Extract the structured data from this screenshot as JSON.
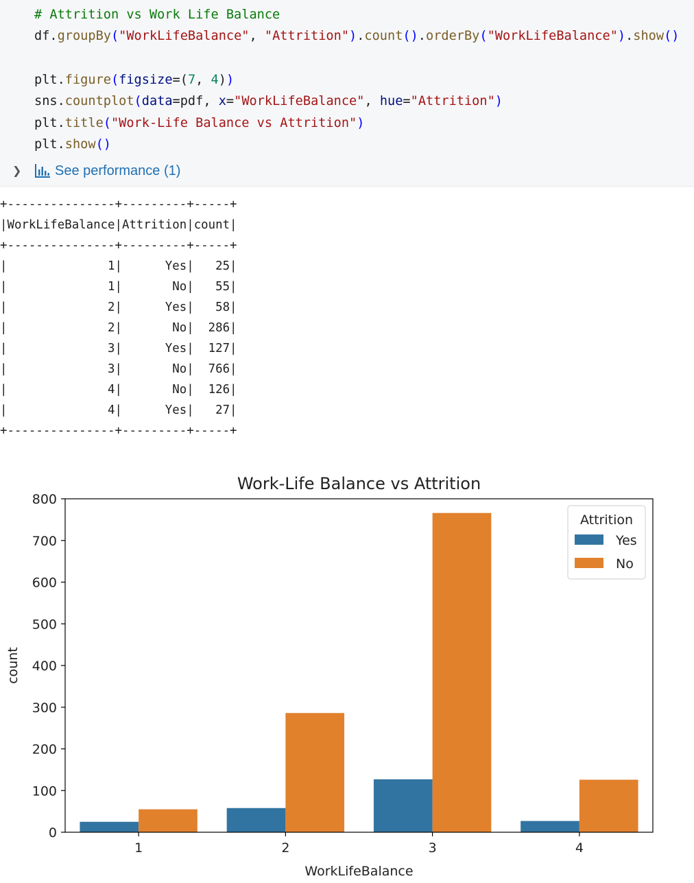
{
  "code_cell": {
    "comment": "# Attrition vs Work Life Balance",
    "line2": {
      "obj": "df",
      "fn1": "groupBy",
      "arg1": "\"WorkLifeBalance\"",
      "arg2": "\"Attrition\"",
      "fn2": "count",
      "fn3": "orderBy",
      "arg3": "\"WorkLifeBalance\"",
      "fn4": "show"
    },
    "line4": {
      "obj": "plt",
      "fn": "figure",
      "param": "figsize",
      "n1": "7",
      "n2": "4"
    },
    "line5": {
      "obj": "sns",
      "fn": "countplot",
      "p1": "data",
      "v1": "pdf",
      "p2": "x",
      "v2": "\"WorkLifeBalance\"",
      "p3": "hue",
      "v3": "\"Attrition\""
    },
    "line6": {
      "obj": "plt",
      "fn": "title",
      "arg": "\"Work-Life Balance vs Attrition\""
    },
    "line7": {
      "obj": "plt",
      "fn": "show"
    },
    "performance_link": "See performance (1)"
  },
  "table_output": {
    "border": "+---------------+---------+-----+",
    "headers": [
      "WorkLifeBalance",
      "Attrition",
      "count"
    ],
    "rows": [
      [
        "1",
        "Yes",
        "25"
      ],
      [
        "1",
        "No",
        "55"
      ],
      [
        "2",
        "Yes",
        "58"
      ],
      [
        "2",
        "No",
        "286"
      ],
      [
        "3",
        "Yes",
        "127"
      ],
      [
        "3",
        "No",
        "766"
      ],
      [
        "4",
        "No",
        "126"
      ],
      [
        "4",
        "Yes",
        "27"
      ]
    ]
  },
  "chart_data": {
    "type": "bar",
    "title": "Work-Life Balance vs Attrition",
    "xlabel": "WorkLifeBalance",
    "ylabel": "count",
    "categories": [
      "1",
      "2",
      "3",
      "4"
    ],
    "series": [
      {
        "name": "Yes",
        "values": [
          25,
          58,
          127,
          27
        ],
        "color": "#3274a1"
      },
      {
        "name": "No",
        "values": [
          55,
          286,
          766,
          126
        ],
        "color": "#e1812c"
      }
    ],
    "ylim": [
      0,
      800
    ],
    "yticks": [
      0,
      100,
      200,
      300,
      400,
      500,
      600,
      700,
      800
    ],
    "legend": {
      "title": "Attrition",
      "placement": "top-right"
    },
    "grid": false
  }
}
